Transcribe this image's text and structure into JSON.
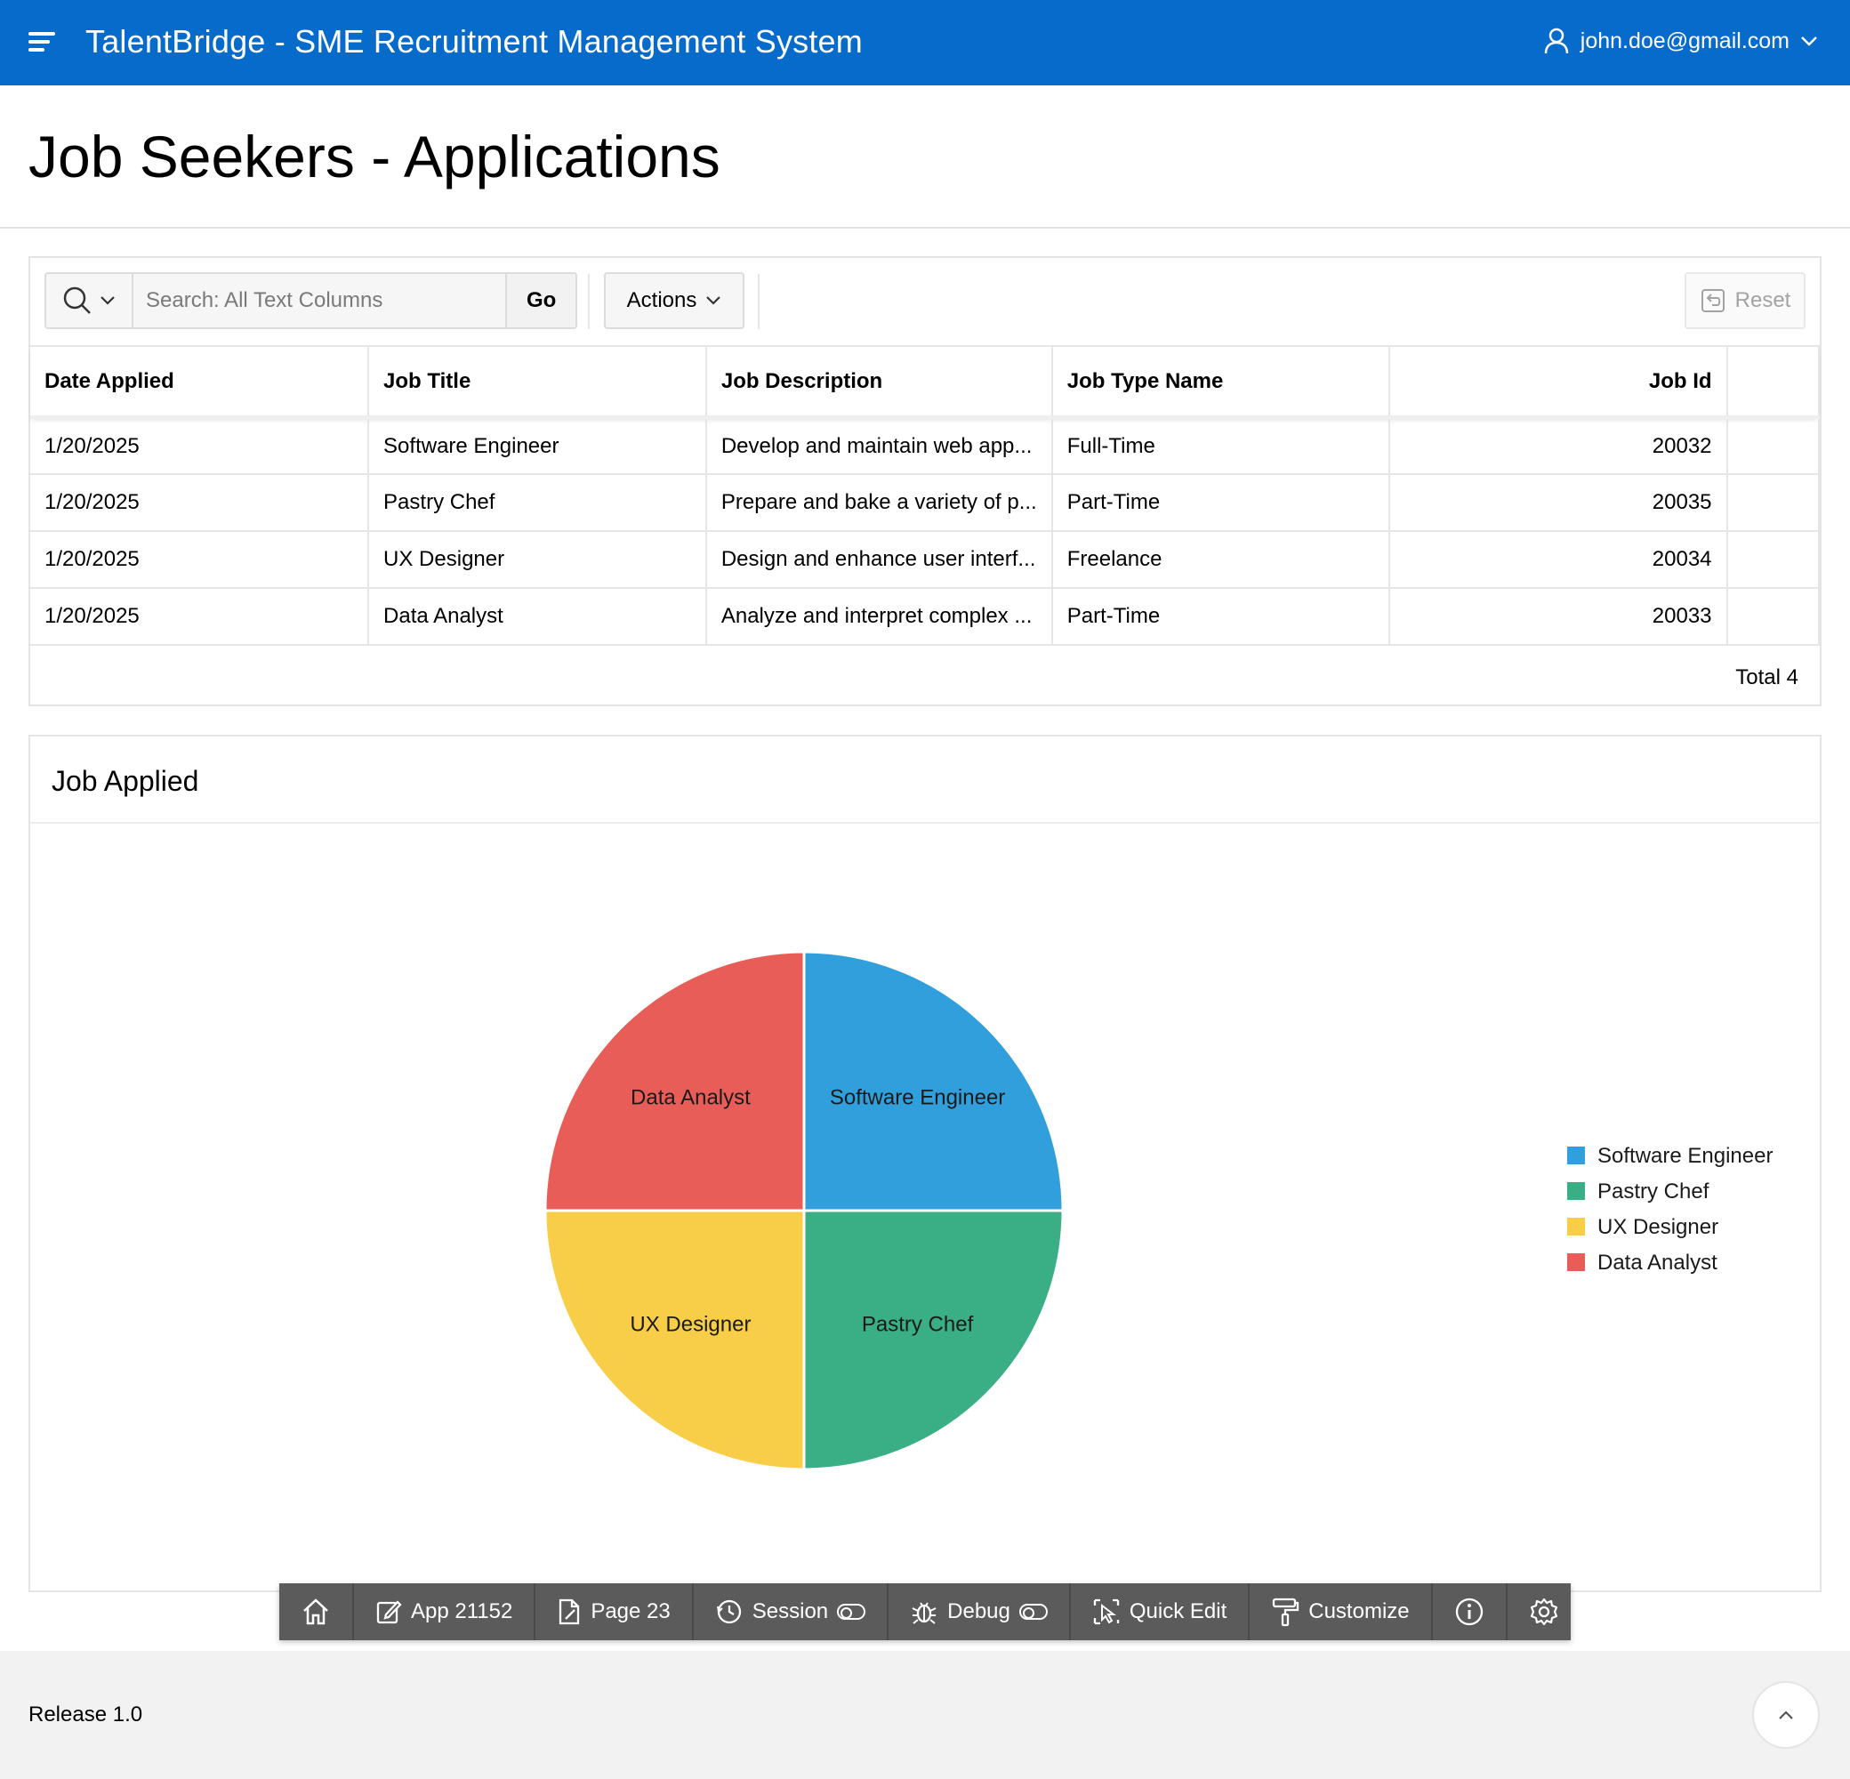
{
  "header": {
    "app_title": "TalentBridge - SME Recruitment Management System",
    "user_email": "john.doe@gmail.com",
    "bar_color": "#066bcb"
  },
  "page": {
    "title": "Job Seekers - Applications"
  },
  "report": {
    "search_placeholder": "Search: All Text Columns",
    "go_label": "Go",
    "actions_label": "Actions",
    "reset_label": "Reset",
    "columns": [
      "Date Applied",
      "Job Title",
      "Job Description",
      "Job Type Name",
      "Job Id"
    ],
    "rows": [
      [
        "1/20/2025",
        "Software Engineer",
        "Develop and maintain web app...",
        "Full-Time",
        "20032"
      ],
      [
        "1/20/2025",
        "Pastry Chef",
        "Prepare and bake a variety of p...",
        "Part-Time",
        "20035"
      ],
      [
        "1/20/2025",
        "UX Designer",
        "Design and enhance user interf...",
        "Freelance",
        "20034"
      ],
      [
        "1/20/2025",
        "Data Analyst",
        "Analyze and interpret complex ...",
        "Part-Time",
        "20033"
      ]
    ],
    "total_label": "Total 4"
  },
  "chart_region": {
    "title": "Job Applied"
  },
  "chart_data": {
    "type": "pie",
    "title": "",
    "categories": [
      "Software Engineer",
      "Pastry Chef",
      "UX Designer",
      "Data Analyst"
    ],
    "values": [
      1,
      1,
      1,
      1
    ],
    "colors": [
      "#309fdb",
      "#3aaf85",
      "#f8cd47",
      "#e85d57"
    ],
    "legend_position": "right"
  },
  "dev_toolbar": {
    "items": [
      {
        "label": "",
        "icon": "home-icon"
      },
      {
        "label": "App 21152",
        "icon": "edit-icon"
      },
      {
        "label": "Page 23",
        "icon": "page-icon"
      },
      {
        "label": "Session",
        "icon": "clock-icon"
      },
      {
        "label": "Debug",
        "icon": "bug-icon"
      },
      {
        "label": "Quick Edit",
        "icon": "quick-edit-icon"
      },
      {
        "label": "Customize",
        "icon": "paint-roller-icon"
      },
      {
        "label": "",
        "icon": "info-icon"
      },
      {
        "label": "",
        "icon": "gear-icon"
      }
    ]
  },
  "footer": {
    "release": "Release 1.0"
  }
}
